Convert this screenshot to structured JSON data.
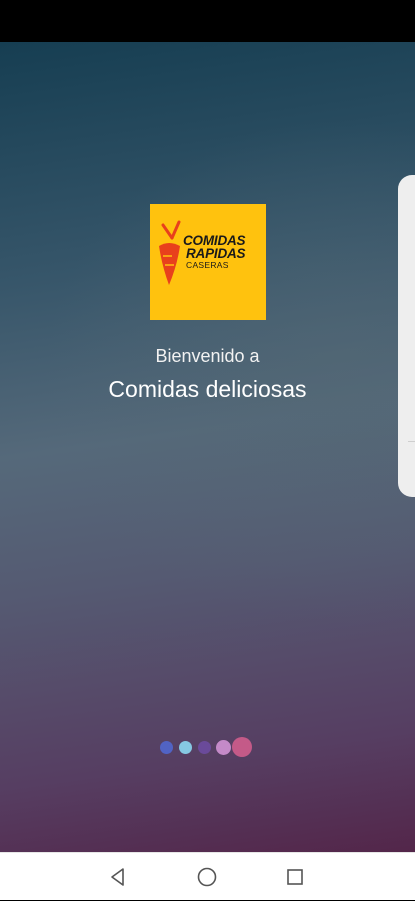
{
  "splash": {
    "logo": {
      "line1": "COMIDAS",
      "line2": "RAPIDAS",
      "line3": "CASERAS",
      "background_color": "#ffc20e",
      "carrot_color": "#e8401c"
    },
    "welcome_text": "Bienvenido a",
    "app_name": "Comidas deliciosas"
  },
  "page_indicator": {
    "page_count": 5,
    "current_page": 5,
    "dot_colors": [
      "#5163c4",
      "#86c8e2",
      "#6a4a9a",
      "#c48ac8",
      "#c45a88"
    ]
  },
  "navigation_bar": {
    "buttons": [
      {
        "name": "back-button",
        "icon": "triangle-left-icon"
      },
      {
        "name": "home-button",
        "icon": "circle-icon"
      },
      {
        "name": "recents-button",
        "icon": "square-icon"
      }
    ]
  }
}
